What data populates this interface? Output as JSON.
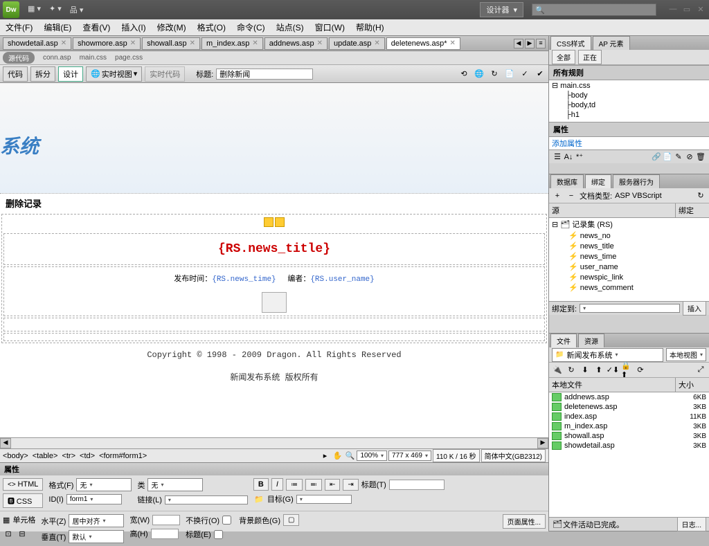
{
  "titlebar": {
    "logo": "Dw",
    "workspace": "设计器"
  },
  "menubar": [
    "文件(F)",
    "编辑(E)",
    "查看(V)",
    "插入(I)",
    "修改(M)",
    "格式(O)",
    "命令(C)",
    "站点(S)",
    "窗口(W)",
    "帮助(H)"
  ],
  "doc_tabs": [
    {
      "label": "showdetail.asp"
    },
    {
      "label": "showmore.asp"
    },
    {
      "label": "showall.asp"
    },
    {
      "label": "m_index.asp"
    },
    {
      "label": "addnews.asp"
    },
    {
      "label": "update.asp"
    },
    {
      "label": "deletenews.asp*",
      "active": true
    }
  ],
  "related": {
    "source_code": "源代码",
    "files": [
      "conn.asp",
      "main.css",
      "page.css"
    ]
  },
  "toolbar": {
    "code": "代码",
    "split": "拆分",
    "design": "设计",
    "live_view": "实时视图",
    "live_code": "实时代码",
    "title_label": "标题:",
    "title_value": "删除新闻"
  },
  "design": {
    "banner_logo": "系统",
    "heading": "删除记录",
    "news_title": "{RS.news_title}",
    "pub_label": "发布时间：",
    "pub_val": "{RS.news_time}",
    "editor_label": "编者：",
    "editor_val": "{RS.user_name}",
    "copyright": "Copyright © 1998 - 2009 Dragon. All Rights Reserved",
    "footer2": "新闻发布系统 版权所有"
  },
  "tag_selector": [
    "<body>",
    "<table>",
    "<tr>",
    "<td>",
    "<form#form1>"
  ],
  "status": {
    "zoom": "100%",
    "dims": "777 x 469",
    "size": "110 K / 16 秒",
    "encoding": "简体中文(GB2312)"
  },
  "properties": {
    "title": "属性",
    "html_btn": "HTML",
    "css_btn": "CSS",
    "format_label": "格式(F)",
    "format_val": "无",
    "id_label": "ID(I)",
    "id_val": "form1",
    "class_label": "类",
    "class_val": "无",
    "link_label": "链接(L)",
    "title2_label": "标题(T)",
    "target_label": "目标(G)",
    "cell_label": "单元格",
    "merge_label": "合并",
    "halign_label": "水平(Z)",
    "halign_val": "居中对齐",
    "valign_label": "垂直(T)",
    "valign_val": "默认",
    "width_label": "宽(W)",
    "height_label": "高(H)",
    "nowrap_label": "不换行(O)",
    "header_label": "标题(E)",
    "bgcolor_label": "背景颜色(G)",
    "page_props": "页面属性..."
  },
  "css_panel": {
    "tabs": [
      "CSS样式",
      "AP 元素"
    ],
    "filter_all": "全部",
    "filter_current": "正在",
    "all_rules": "所有规则",
    "rules": [
      "main.css",
      "body",
      "body,td",
      "h1"
    ],
    "props_h": "属性",
    "add_prop": "添加属性"
  },
  "bind_panel": {
    "tabs": [
      "数据库",
      "绑定",
      "服务器行为"
    ],
    "doctype_label": "文档类型:",
    "doctype": "ASP VBScript",
    "col_source": "源",
    "col_bind": "绑定",
    "recordset": "记录集 (RS)",
    "fields": [
      "news_no",
      "news_title",
      "news_time",
      "user_name",
      "newspic_link",
      "news_comment"
    ],
    "bind_to": "绑定到:",
    "insert_btn": "插入"
  },
  "files_panel": {
    "tabs": [
      "文件",
      "资源"
    ],
    "site": "新闻发布系统",
    "view": "本地视图",
    "col_name": "本地文件",
    "col_size": "大小",
    "files": [
      {
        "name": "addnews.asp",
        "size": "6KB"
      },
      {
        "name": "deletenews.asp",
        "size": "3KB"
      },
      {
        "name": "index.asp",
        "size": "11KB"
      },
      {
        "name": "m_index.asp",
        "size": "3KB"
      },
      {
        "name": "showall.asp",
        "size": "3KB"
      },
      {
        "name": "showdetail.asp",
        "size": "3KB"
      }
    ],
    "status": "文件活动已完成。",
    "log_btn": "日志..."
  }
}
